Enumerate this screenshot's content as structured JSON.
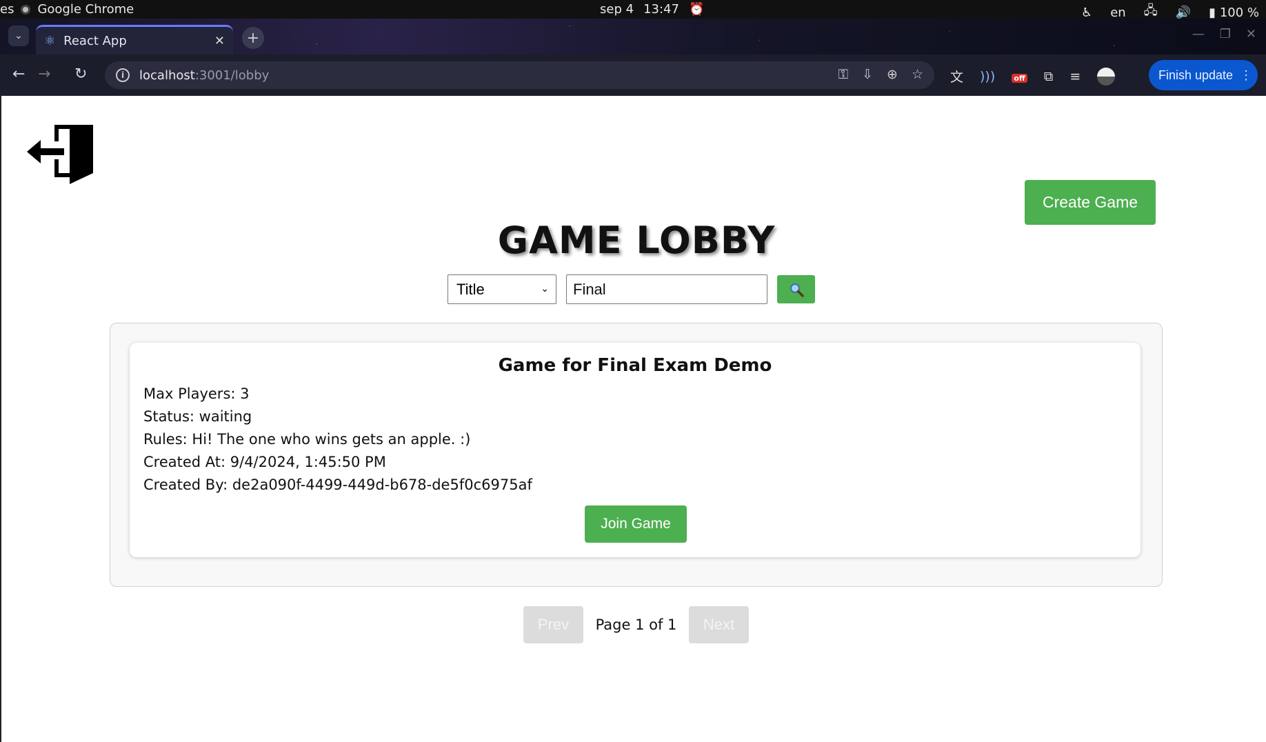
{
  "os_bar": {
    "app_prefix": "es",
    "app_name": "Google Chrome",
    "date": "sep 4",
    "time": "13:47",
    "language": "en",
    "battery": "100 %"
  },
  "browser": {
    "tab_title": "React App",
    "url_host": "localhost",
    "url_rest": ":3001/lobby",
    "finish_update_label": "Finish update",
    "extension_badge": "off"
  },
  "page": {
    "title": "GAME LOBBY",
    "create_game_label": "Create Game",
    "filter": {
      "selected": "Title",
      "query": "Final"
    },
    "search_icon": "magnifier-icon",
    "games": [
      {
        "title": "Game for Final Exam Demo",
        "max_players": "Max Players: 3",
        "status": "Status: waiting",
        "rules": "Rules: Hi! The one who wins gets an apple. :)",
        "created_at": "Created At: 9/4/2024, 1:45:50 PM",
        "created_by": "Created By: de2a090f-4499-449d-b678-de5f0c6975af",
        "join_label": "Join Game"
      }
    ],
    "pagination": {
      "prev_label": "Prev",
      "page_label": "Page 1 of 1",
      "next_label": "Next"
    }
  },
  "colors": {
    "accent_green": "#4caf50",
    "disabled_gray": "#dcdcdc",
    "update_blue": "#0b57d0"
  }
}
